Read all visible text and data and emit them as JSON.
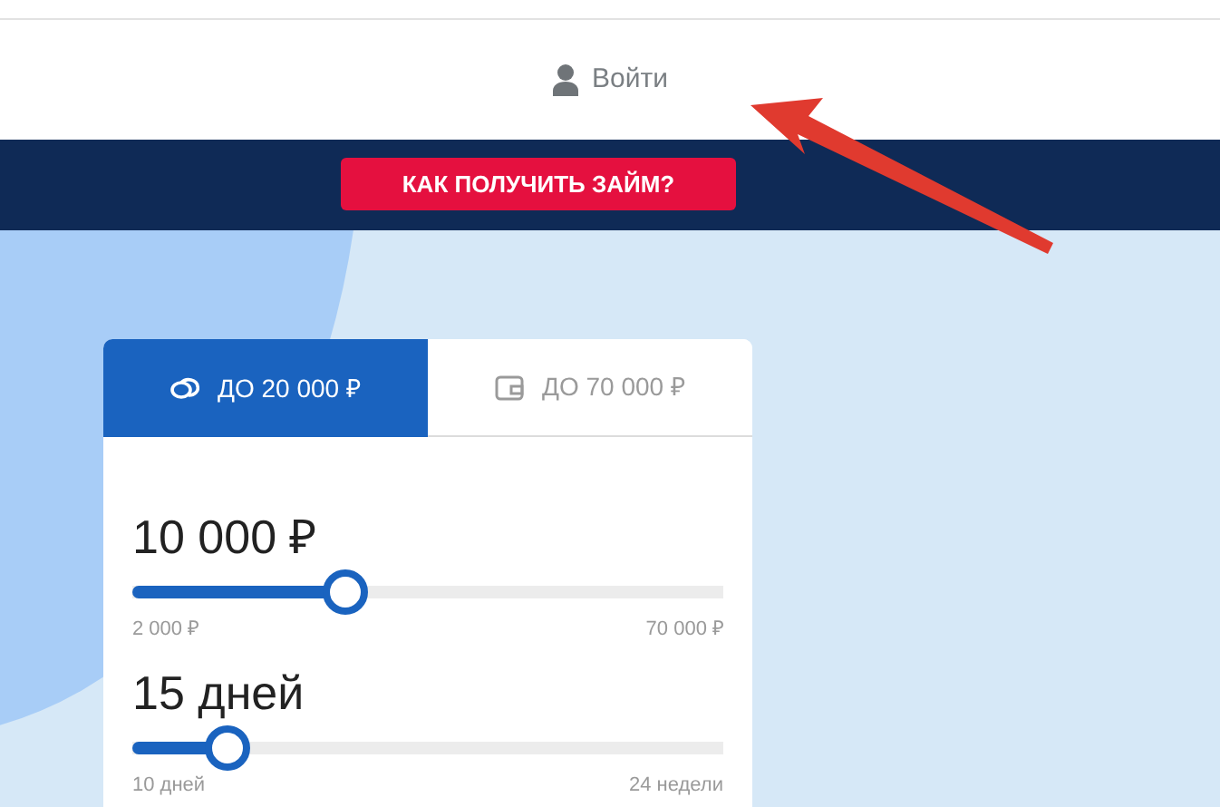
{
  "header": {
    "login": "Войти"
  },
  "banner": {
    "button": "КАК ПОЛУЧИТЬ ЗАЙМ?"
  },
  "tabs": [
    {
      "label": "ДО 20 000 ₽",
      "kind": "coins",
      "selected": true
    },
    {
      "label": "ДО 70 000 ₽",
      "kind": "wallet",
      "selected": false
    }
  ],
  "sliders": [
    {
      "value": "10 000 ₽",
      "level": 0.36,
      "min": "2 000 ₽",
      "max": "70 000 ₽"
    },
    {
      "value": "15 дней",
      "level": 0.16,
      "min": "10 дней",
      "max": "24 недели"
    }
  ]
}
